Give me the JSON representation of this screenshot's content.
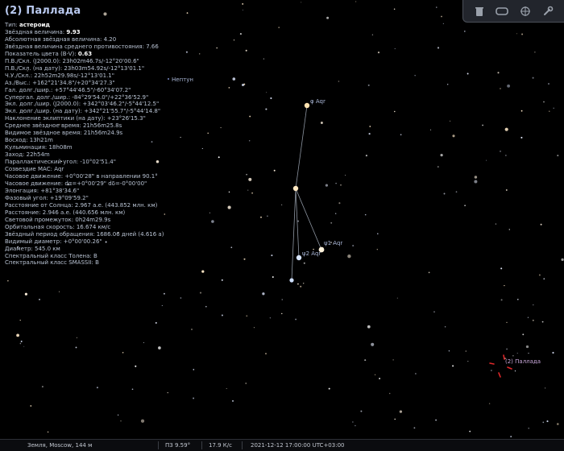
{
  "object_title": "(2) Паллада",
  "info_lines": [
    {
      "label": "Тип: ",
      "value": "астероид",
      "highlight": true
    },
    {
      "label": "Звёздная величина: ",
      "value": "9.93",
      "highlight": true
    },
    {
      "label": "Абсолютная звёздная величина: ",
      "value": "4.20"
    },
    {
      "label": "Звёздная величина среднего противостояния: ",
      "value": "7.66"
    },
    {
      "label": "Показатель цвета (B-V): ",
      "value": "0.63",
      "highlight": true
    },
    {
      "label": "П.В./Скл. (J2000.0): ",
      "value": "23h02m46.7s/-12°20'00.6\""
    },
    {
      "label": "П.В./Скл. (на дату): ",
      "value": "23h03m54.92s/-12°13'01.1\""
    },
    {
      "label": "Ч.У./Скл.: ",
      "value": "22h52m29.98s/-12°13'01.1\""
    },
    {
      "label": "Аз./Выс.: ",
      "value": "+162°21'34.8\"/+20°34'27.3\""
    },
    {
      "label": "Гал. долг./шир.: ",
      "value": "+57°44'46.5\"/-60°34'07.2\""
    },
    {
      "label": "Супергал. долг./шир.: ",
      "value": "-84°29'54.0\"/+22°36'52.9\""
    },
    {
      "label": "Экл. долг./шир. (J2000.0): ",
      "value": "+342°03'46.2\"/-5°44'12.5\""
    },
    {
      "label": "Экл. долг./шир. (на дату): ",
      "value": "+342°21'55.7\"/-5°44'14.8\""
    },
    {
      "label": "Наклонение эклиптики (на дату): ",
      "value": "+23°26'15.3\""
    },
    {
      "label": "Среднее звёздное время: ",
      "value": "21h56m25.8s"
    },
    {
      "label": "Видимое звёздное время: ",
      "value": "21h56m24.9s"
    },
    {
      "label": "Восход: ",
      "value": "13h21m"
    },
    {
      "label": "Кульминация: ",
      "value": "18h08m"
    },
    {
      "label": "Заход: ",
      "value": "22h54m"
    },
    {
      "label": "Параллактический угол: ",
      "value": "-10°02'51.4\""
    },
    {
      "label": "Созвездие МАС: ",
      "value": "Aqr"
    },
    {
      "label": "Часовое движение: ",
      "value": "+0°00'28\" в направлении 90.1°"
    },
    {
      "label": "Часовое движение: ",
      "value": "dα=+0°00'29\" dδ=-0°00'00\""
    },
    {
      "label": "Элонгация: ",
      "value": "+81°38'34.6\""
    },
    {
      "label": "Фазовый угол: ",
      "value": "+19°09'59.2\""
    },
    {
      "label": "Расстояние от Солнца: ",
      "value": "2.967 а.е. (443.852 млн. км)"
    },
    {
      "label": "Расстояние: ",
      "value": "2.946 а.е. (440.656 млн. км)"
    },
    {
      "label": "Световой промежуток: ",
      "value": "0h24m29.9s"
    },
    {
      "label": "Орбитальная скорость: ",
      "value": "16.674 км/с"
    },
    {
      "label": "Звёздный период обращения: ",
      "value": "1686.06 дней (4.616 a)"
    },
    {
      "label": "Видимый диаметр: ",
      "value": "+0°00'00.26\""
    },
    {
      "label": "Диаметр: ",
      "value": "545.0 км"
    },
    {
      "label": "Спектральный класс Толена: ",
      "value": "B"
    },
    {
      "label": "Спектральный класс SMASSII: ",
      "value": "B"
    }
  ],
  "sky_labels": {
    "neptune": "Нептун",
    "phi_aqr": "φ Aqr",
    "psi1_aqr": "ψ1 Aqr",
    "psi2_aqr": "ψ2 Aqr",
    "pallas": "(2) Паллада"
  },
  "toolbar": {
    "icons": [
      "trash-icon",
      "eye-icon",
      "grid-target-icon",
      "wrench-icon"
    ]
  },
  "statusbar": {
    "location": "Земля, Moscow, 144 м",
    "fov": "ПЗ 9.59°",
    "fps": "17.9 К/с",
    "datetime": "2021-12-12 17:00:00 UTC+03:00"
  },
  "colors": {
    "background": "#000000",
    "title": "#b9c9ef",
    "constellation_line": "#9aa2ad",
    "marker": "#e0282a",
    "label": "#a9b6d6"
  }
}
